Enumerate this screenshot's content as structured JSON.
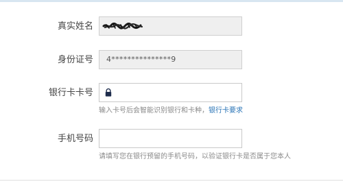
{
  "form": {
    "real_name": {
      "label": "真实姓名",
      "value_masked": true
    },
    "id_number": {
      "label": "身份证号",
      "value": "4***************9"
    },
    "bank_card": {
      "label": "银行卡卡号",
      "value": "",
      "icon": "lock-icon",
      "hint_text": "输入卡号后会智能识别银行和卡种，",
      "hint_link": "银行卡要求"
    },
    "phone": {
      "label": "手机号码",
      "value": "",
      "hint_text": "请填写您在银行预留的手机号码，以验证银行卡是否属于您本人"
    }
  },
  "colors": {
    "readonly_bg": "#efefef",
    "border": "#cfcfcf",
    "link": "#2a74b6",
    "hint": "#8a8a8a",
    "label": "#444444",
    "lock": "#1f2d4d"
  }
}
